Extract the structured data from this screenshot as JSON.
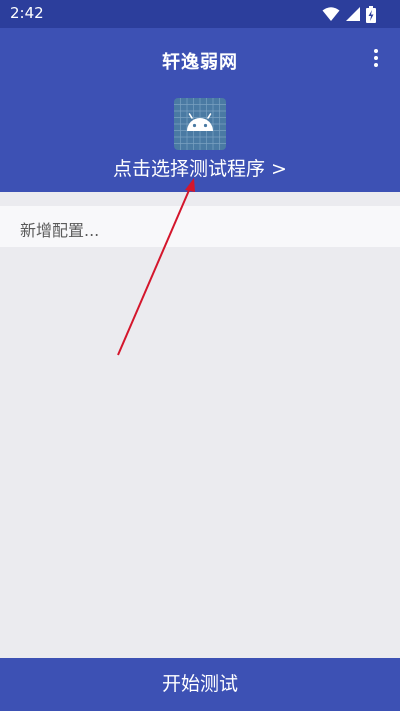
{
  "status_bar": {
    "time": "2:42",
    "icons": [
      "wifi-icon",
      "cellular-signal-icon",
      "battery-charging-icon"
    ]
  },
  "header": {
    "title": "轩逸弱网",
    "select_program_label": "点击选择测试程序 >",
    "menu_icon": "more-vert-icon",
    "app_icon": "android-app-icon"
  },
  "config": {
    "add_label": "新增配置..."
  },
  "footer": {
    "start_label": "开始测试"
  },
  "colors": {
    "status_bar": "#2c3e9c",
    "header": "#3d51b4",
    "background": "#ebebef",
    "config_row": "#f8f8fa",
    "arrow": "#d4162c",
    "icon_bg": "#4a7aa3"
  }
}
